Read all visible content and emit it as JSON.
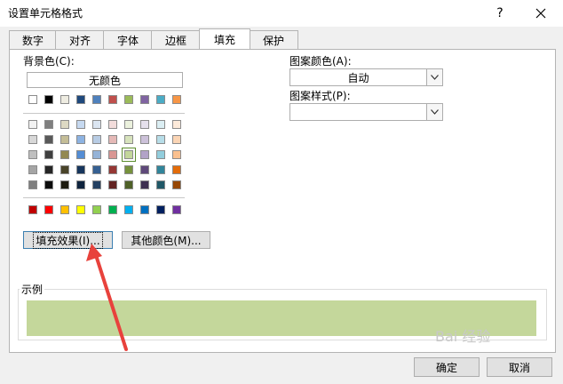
{
  "window": {
    "title": "设置单元格格式",
    "help": "?",
    "close": "✕"
  },
  "tabs": [
    "数字",
    "对齐",
    "字体",
    "边框",
    "填充",
    "保护"
  ],
  "active_tab": "填充",
  "fill": {
    "background_label": "背景色(C):",
    "no_color_label": "无颜色",
    "theme_colors_top": [
      "#ffffff",
      "#000000",
      "#eeece1",
      "#1f497d",
      "#4f81bd",
      "#c0504d",
      "#9bbb59",
      "#8064a2",
      "#4bacc6",
      "#f79646"
    ],
    "theme_shades": [
      [
        "#f2f2f2",
        "#7f7f7f",
        "#ddd9c3",
        "#c6d9f0",
        "#dbe5f1",
        "#f2dcdb",
        "#ebf1dd",
        "#e5e0ec",
        "#dbeef3",
        "#fdeada"
      ],
      [
        "#d8d8d8",
        "#595959",
        "#c4bd97",
        "#8db3e2",
        "#b8cce4",
        "#e5b9b7",
        "#d7e3bc",
        "#ccc1d9",
        "#b7dde8",
        "#fbd5b5"
      ],
      [
        "#bfbfbf",
        "#3f3f3f",
        "#938953",
        "#548dd4",
        "#95b3d7",
        "#d99694",
        "#c3d69b",
        "#b2a2c7",
        "#92cddc",
        "#fac08f"
      ],
      [
        "#a5a5a5",
        "#262626",
        "#494429",
        "#17365d",
        "#366092",
        "#953734",
        "#76923c",
        "#5f497a",
        "#31859b",
        "#e36c09"
      ],
      [
        "#7f7f7f",
        "#0c0c0c",
        "#1d1b10",
        "#0f243e",
        "#244061",
        "#632423",
        "#4f6128",
        "#3f3151",
        "#205867",
        "#974806"
      ]
    ],
    "selected_swatch": "#c3d69b",
    "standard_colors": [
      "#c00000",
      "#ff0000",
      "#ffc000",
      "#ffff00",
      "#92d050",
      "#00b050",
      "#00b0f0",
      "#0070c0",
      "#002060",
      "#7030a0"
    ],
    "fill_effects_label": "填充效果(I)...",
    "more_colors_label": "其他颜色(M)...",
    "pattern_color_label": "图案颜色(A):",
    "pattern_color_value": "自动",
    "pattern_style_label": "图案样式(P):",
    "pattern_style_value": "",
    "sample_label": "示例",
    "sample_color": "#c4d79b"
  },
  "buttons": {
    "ok": "确定",
    "cancel": "取消"
  },
  "watermark": "Bai 经验"
}
